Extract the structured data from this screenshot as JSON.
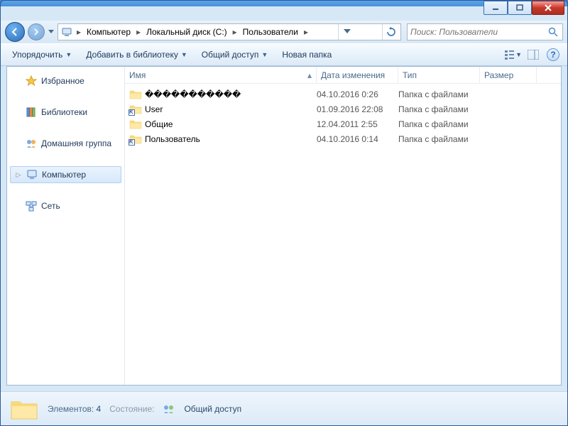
{
  "breadcrumb": {
    "segments": [
      "Компьютер",
      "Локальный диск (C:)",
      "Пользователи"
    ]
  },
  "search": {
    "placeholder": "Поиск: Пользователи"
  },
  "toolbar": {
    "organize": "Упорядочить",
    "include": "Добавить в библиотеку",
    "share": "Общий доступ",
    "new_folder": "Новая папка"
  },
  "sidebar": {
    "favorites": "Избранное",
    "libraries": "Библиотеки",
    "homegroup": "Домашняя группа",
    "computer": "Компьютер",
    "network": "Сеть"
  },
  "columns": {
    "name": "Имя",
    "date": "Дата изменения",
    "type": "Тип",
    "size": "Размер"
  },
  "files": [
    {
      "name": "�����������",
      "date": "04.10.2016 0:26",
      "type": "Папка с файлами",
      "shortcut": false
    },
    {
      "name": "User",
      "date": "01.09.2016 22:08",
      "type": "Папка с файлами",
      "shortcut": true
    },
    {
      "name": "Общие",
      "date": "12.04.2011 2:55",
      "type": "Папка с файлами",
      "shortcut": false
    },
    {
      "name": "Пользователь",
      "date": "04.10.2016 0:14",
      "type": "Папка с файлами",
      "shortcut": true
    }
  ],
  "statusbar": {
    "elements_label": "Элементов:",
    "elements_count": "4",
    "state_label": "Состояние:",
    "state_value": "Общий доступ"
  }
}
